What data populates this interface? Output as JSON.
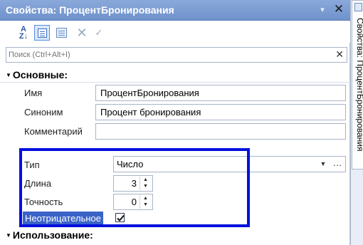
{
  "window": {
    "title": "Свойства: ПроцентБронирования"
  },
  "toolbar": {
    "sort_icon_text": "A\nZ",
    "buttons": [
      "sort-alphabetical",
      "categorized-view",
      "filter",
      "clear",
      "apply"
    ]
  },
  "search": {
    "placeholder": "Поиск (Ctrl+Alt+I)",
    "value": ""
  },
  "groups": {
    "main": "Основные:",
    "use": "Использование:"
  },
  "properties": {
    "name": {
      "label": "Имя",
      "value": "ПроцентБронирования"
    },
    "synonym": {
      "label": "Синоним",
      "value": "Процент бронирования"
    },
    "comment": {
      "label": "Комментарий",
      "value": ""
    },
    "type": {
      "label": "Тип",
      "value": "Число"
    },
    "length": {
      "label": "Длина",
      "value": "3"
    },
    "precision": {
      "label": "Точность",
      "value": "0"
    },
    "nonnegative": {
      "label": "Неотрицательное",
      "checked": true
    }
  },
  "sidebar": {
    "tab_label": "Свойства: ПроцентБронирования"
  },
  "colors": {
    "titlebar": "#7b9bd2",
    "highlight_frame": "#0010dd",
    "selected_label": "#3a63c8"
  }
}
